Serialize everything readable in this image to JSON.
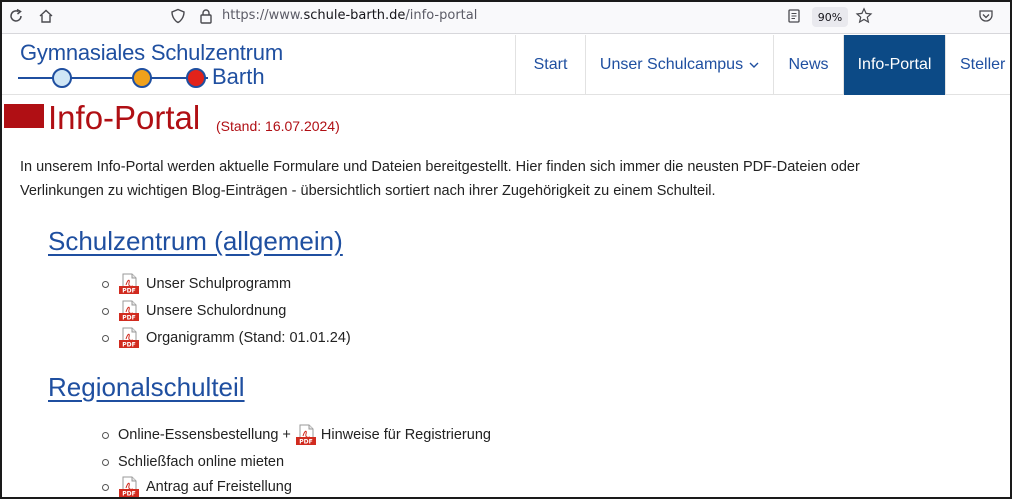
{
  "browser": {
    "url_prefix": "https://www.",
    "url_domain": "schule-barth.de",
    "url_path": "/info-portal",
    "zoom": "90%",
    "icons": [
      "reload-icon",
      "home-icon",
      "shield-icon",
      "lock-icon",
      "reader-icon",
      "star-icon",
      "pocket-icon"
    ]
  },
  "site": {
    "logo_line1": "Gymnasiales Schulzentrum",
    "logo_line2": "Barth",
    "logo_dot_colors": [
      "#cfe6f5",
      "#f0a11b",
      "#e2231a"
    ]
  },
  "nav": {
    "items": [
      {
        "label": "Start"
      },
      {
        "label": "Unser Schulcampus"
      },
      {
        "label": "News"
      },
      {
        "label": "Info-Portal"
      },
      {
        "label": "Steller"
      }
    ]
  },
  "page": {
    "title": "Info-Portal",
    "date_note": "(Stand: 16.07.2024)",
    "intro_line1": "In unserem Info-Portal werden aktuelle Formulare und Dateien bereitgestellt. Hier finden sich immer die neusten PDF-Dateien oder",
    "intro_line2": "Verlinkungen zu wichtigen Blog-Einträgen - übersichtlich sortiert nach ihrer Zugehörigkeit zu einem Schulteil."
  },
  "sections": [
    {
      "heading": "Schulzentrum (allgemein)",
      "items": [
        {
          "label": "Unser Schulprogramm"
        },
        {
          "label": "Unsere Schulordnung"
        },
        {
          "label": "Organigramm (Stand: 01.01.24)"
        }
      ]
    },
    {
      "heading": "Regionalschulteil",
      "items": [
        {
          "prefix": "Online-Essensbestellung +",
          "label": "Hinweise für Registrierung"
        },
        {
          "label": "Schließfach online mieten"
        },
        {
          "label": "Antrag auf Freistellung"
        }
      ]
    }
  ],
  "colors": {
    "brand_blue": "#1f4fa0",
    "nav_active": "#0c4a86",
    "title_red": "#b00f14"
  }
}
